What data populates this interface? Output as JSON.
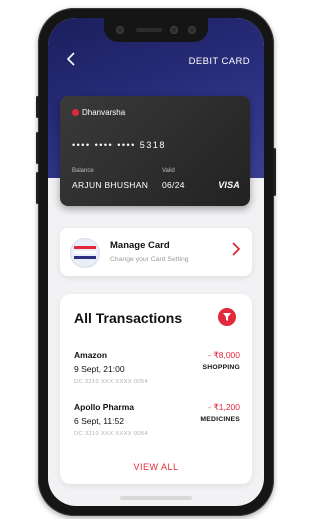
{
  "header": {
    "title": "DEBIT CARD",
    "back_icon": "chevron-left-icon"
  },
  "card": {
    "bank_name": "Dhanvarsha",
    "masked_number": "•••• •••• •••• 5318",
    "balance_label": "Balance",
    "holder_name": "ARJUN BHUSHAN",
    "valid_label": "Valid",
    "valid_date": "06/24",
    "network": "VISA"
  },
  "manage_card": {
    "title": "Manage Card",
    "subtitle": "Change your Card Setting",
    "icon": "card-stack-icon",
    "chevron": "chevron-right-icon"
  },
  "transactions": {
    "title": "All Transactions",
    "filter_icon": "filter-icon",
    "items": [
      {
        "merchant": "Amazon",
        "amount": "- ₹8,000",
        "datetime": "9 Sept, 21:00",
        "category": "SHOPPING",
        "account": "DC 3210 XXX XXXX 0054"
      },
      {
        "merchant": "Apollo Pharma",
        "amount": "- ₹1,200",
        "datetime": "6 Sept, 11:52",
        "category": "MEDICINES",
        "account": "DC 3210 XXX XXXX 0054"
      }
    ],
    "view_all": "VIEW ALL"
  },
  "colors": {
    "accent": "#e2283b",
    "header_bg": "#2a2f7f",
    "card_bg": "#2b2b2b",
    "screen_bg": "#f2f2f4"
  }
}
